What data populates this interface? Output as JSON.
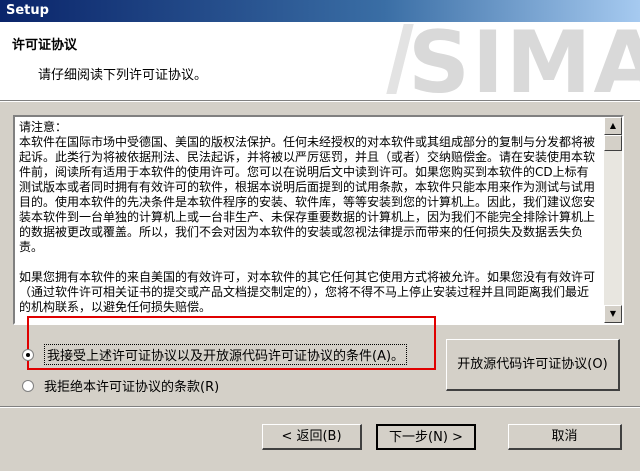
{
  "window": {
    "title": "Setup"
  },
  "header": {
    "title": "许可证协议",
    "subtitle": "请仔细阅读下列许可证协议。",
    "brand_text": "SIMA"
  },
  "license_text": {
    "p1": "请注意：",
    "p2": "本软件在国际市场中受德国、美国的版权法保护。任何未经授权的对本软件或其组成部分的复制与分发都将被起诉。此类行为将被依据刑法、民法起诉，并将被以严厉惩罚，并且（或者）交纳赔偿金。请在安装使用本软件前，阅读所有适用于本软件的使用许可。您可以在说明后文中读到许可。如果您购买到本软件的CD上标有测试版本或者同时拥有有效许可的软件，根据本说明后面提到的试用条款，本软件只能本用来作为测试与试用目的。使用本软件的先决条件是本软件程序的安装、软件库，等等安装到您的计算机上。因此，我们建议您安装本软件到一台单独的计算机上或一台非生产、未保存重要数据的计算机上，因为我们不能完全排除计算机上的数据被更改或覆盖。所以，我们不会对因为本软件的安装或忽视法律提示而带来的任何损失及数据丢失负责。",
    "p3": "如果您拥有本软件的来自美国的有效许可，对本软件的其它任何其它使用方式将被允许。如果您没有有效许可（通过软件许可相关证书的提交或产品文档提交制定的），您将不得不马上停止安装过程并且同距离我们最近的机构联系，以避免任何损失赔偿。"
  },
  "options": {
    "accept_label": "我接受上述许可证协议以及开放源代码许可证协议的条件(A)。",
    "reject_label": "我拒绝本许可证协议的条款(R)"
  },
  "buttons": {
    "open_source": "开放源代码许可证协议(O)",
    "back": "< 返回(B)",
    "next": "下一步(N) >",
    "cancel": "取消"
  },
  "colors": {
    "highlight_box": "#e00000",
    "titlebar": "#0a246a"
  }
}
